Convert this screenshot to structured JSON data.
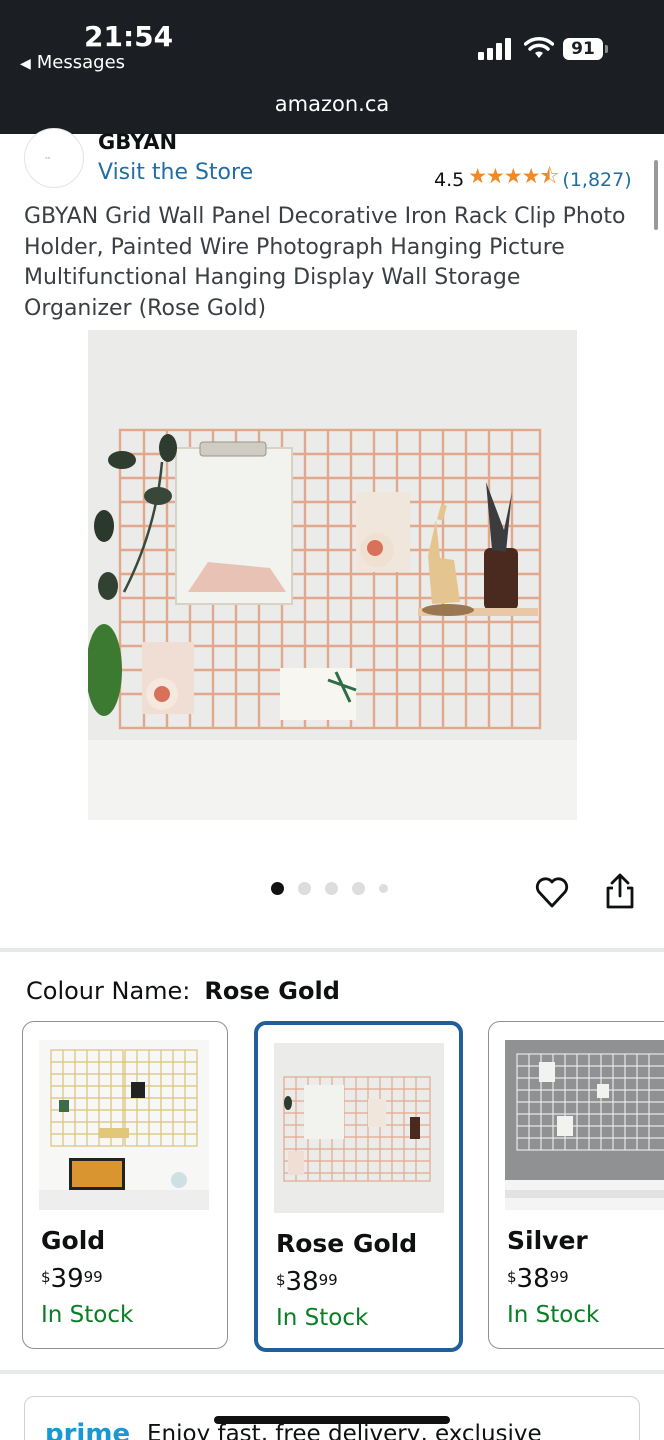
{
  "status_bar": {
    "time": "21:54",
    "back_label": "Messages",
    "battery": "91",
    "url": "amazon.ca"
  },
  "store": {
    "brand": "GBYAN",
    "visit_link": "Visit the Store",
    "rating": "4.5",
    "stars": "★★★★⯪",
    "review_count": "(1,827)"
  },
  "product": {
    "title": "GBYAN Grid Wall Panel Decorative Iron Rack Clip Photo Holder, Painted Wire Photograph Hanging Picture Multifunctional Hanging Display Wall Storage Organizer (Rose Gold)"
  },
  "gallery": {
    "image_count": 5,
    "active_index": 0
  },
  "variant_selector": {
    "label": "Colour Name:",
    "selected": "Rose Gold"
  },
  "variants": [
    {
      "name": "Gold",
      "currency": "$",
      "price_whole": "39",
      "price_fraction": "99",
      "stock": "In Stock",
      "selected": false
    },
    {
      "name": "Rose Gold",
      "currency": "$",
      "price_whole": "38",
      "price_fraction": "99",
      "stock": "In Stock",
      "selected": true
    },
    {
      "name": "Silver",
      "currency": "$",
      "price_whole": "38",
      "price_fraction": "99",
      "stock": "In Stock",
      "selected": false
    }
  ],
  "prime": {
    "logo": "prime",
    "text": "Enjoy fast, free delivery, exclusive"
  },
  "colors": {
    "link": "#1f6fa3",
    "star": "#f08a24",
    "in_stock": "#087f23",
    "selected_border": "#1f5f9a",
    "prime": "#1a98d6",
    "status_bar": "#1b1f23"
  }
}
